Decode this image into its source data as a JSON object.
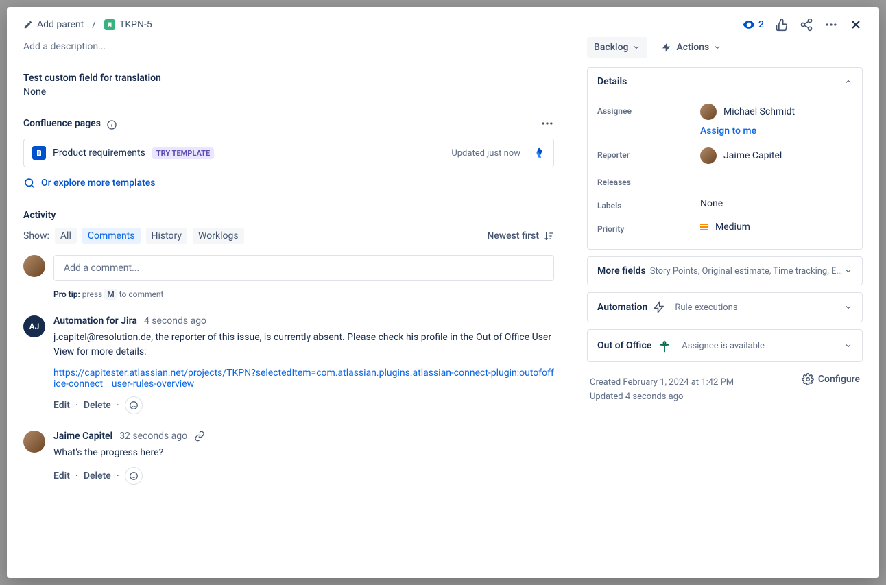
{
  "breadcrumbs": {
    "add_parent": "Add parent",
    "issue_key": "TKPN-5"
  },
  "header": {
    "watch_count": "2"
  },
  "description": {
    "placeholder": "Add a description..."
  },
  "custom_field": {
    "label": "Test custom field for translation",
    "value": "None"
  },
  "confluence": {
    "section_label": "Confluence pages",
    "page_title": "Product requirements",
    "try_template": "TRY TEMPLATE",
    "updated": "Updated just now",
    "explore": "Or explore more templates"
  },
  "activity": {
    "label": "Activity",
    "show_label": "Show:",
    "tabs": {
      "all": "All",
      "comments": "Comments",
      "history": "History",
      "worklogs": "Worklogs"
    },
    "newest_first": "Newest first",
    "comment_placeholder": "Add a comment...",
    "pro_tip_label": "Pro tip:",
    "pro_tip_pre": "press",
    "pro_tip_key": "M",
    "pro_tip_post": "to comment"
  },
  "comments": [
    {
      "author": "Automation for Jira",
      "avatar_initials": "AJ",
      "time": "4 seconds ago",
      "text": "j.capitel@resolution.de, the reporter of this issue, is currently absent. Please check his profile in the Out of Office User View for more details:",
      "link": "https://capitester.atlassian.net/projects/TKPN?selectedItem=com.atlassian.plugins.atlassian-connect-plugin:outofoffice-connect__user-rules-overview"
    },
    {
      "author": "Jaime Capitel",
      "time": "32 seconds ago",
      "text": "What's the progress here?"
    }
  ],
  "comment_actions": {
    "edit": "Edit",
    "delete": "Delete"
  },
  "side": {
    "status": "Backlog",
    "actions": "Actions",
    "details": {
      "title": "Details",
      "assignee_label": "Assignee",
      "assignee_value": "Michael Schmidt",
      "assign_to_me": "Assign to me",
      "reporter_label": "Reporter",
      "reporter_value": "Jaime Capitel",
      "releases_label": "Releases",
      "labels_label": "Labels",
      "labels_value": "None",
      "priority_label": "Priority",
      "priority_value": "Medium"
    },
    "more_fields": {
      "title": "More fields",
      "sub": "Story Points, Original estimate, Time tracking, Epic ..."
    },
    "automation": {
      "title": "Automation",
      "sub": "Rule executions"
    },
    "ooo": {
      "title": "Out of Office",
      "sub": "Assignee is available"
    },
    "meta": {
      "created": "Created February 1, 2024 at 1:42 PM",
      "updated": "Updated 4 seconds ago",
      "configure": "Configure"
    }
  }
}
